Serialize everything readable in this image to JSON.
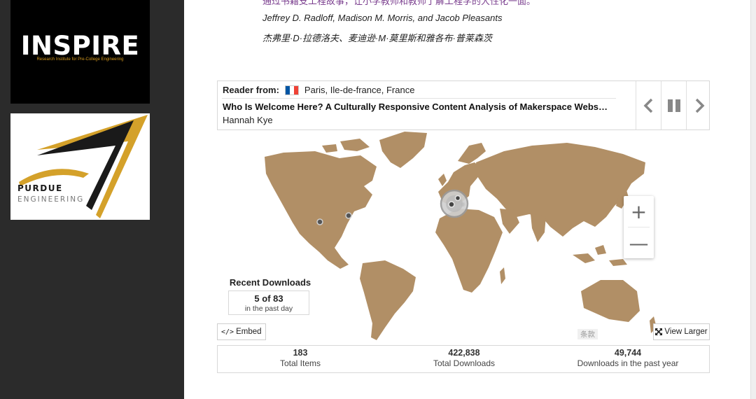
{
  "sidebar": {
    "inspire_logo": {
      "wordmark": "INSPIRE",
      "subtitle": "Research Institute for Pre-College Engineering"
    },
    "purdue_logo": {
      "wordmark": "PURDUE",
      "subtitle": "ENGINEERING"
    }
  },
  "article": {
    "top_clipped_text": "通过书籍支工程故事，让小学教师和教师了解工程学的大性化一面。",
    "authors_en": "Jeffrey D. Radloff, Madison M. Morris, and Jacob Pleasants",
    "authors_zh": "杰弗里·D·拉德洛夫、麦迪逊·M·莫里斯和雅各布·普莱森茨"
  },
  "reader": {
    "label": "Reader from:",
    "location": "Paris, Ile-de-france, France",
    "flag_colors": [
      "#0055A4",
      "#FFFFFF",
      "#EF4135"
    ],
    "title": "Who Is Welcome Here? A Culturally Responsive Content Analysis of Makerspace Webs…",
    "author": "Hannah Kye",
    "controls": {
      "prev_icon": "chevron-left-icon",
      "pause_icon": "pause-icon",
      "next_icon": "chevron-right-icon"
    }
  },
  "map": {
    "land_color": "#b18f66",
    "zoom_in": "+",
    "zoom_out": "—",
    "attribution": "条款",
    "recent": {
      "title": "Recent Downloads",
      "count": "5 of 83",
      "period": "in the past day"
    },
    "embed_label": "Embed",
    "embed_icon": "code-icon",
    "view_larger_label": "View Larger",
    "view_larger_icon": "expand-icon"
  },
  "stats": [
    {
      "value": "183",
      "label": "Total Items"
    },
    {
      "value": "422,838",
      "label": "Total Downloads"
    },
    {
      "value": "49,744",
      "label": "Downloads in the past year"
    }
  ]
}
